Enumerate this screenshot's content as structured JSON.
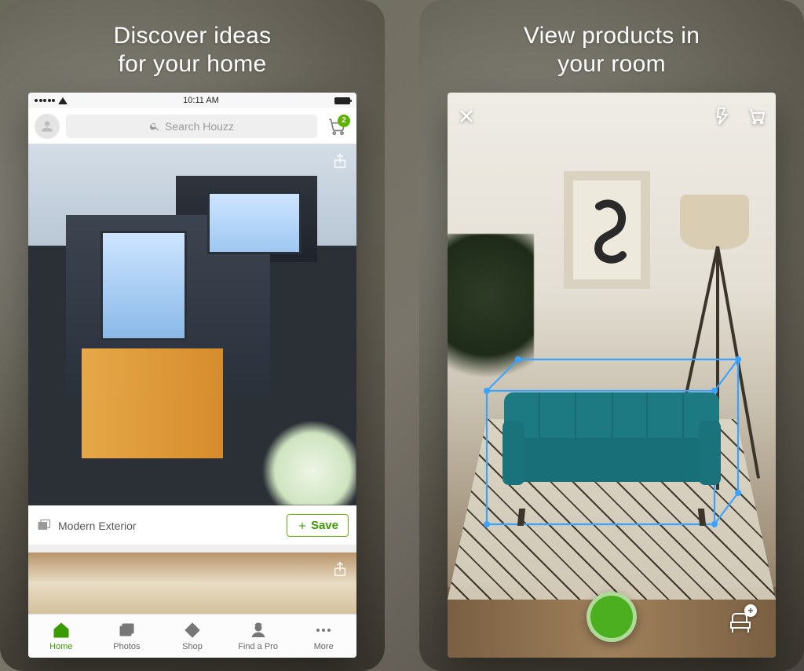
{
  "left": {
    "title_line1": "Discover ideas",
    "title_line2": "for your home",
    "statusbar_time": "10:11 AM",
    "search_placeholder": "Search Houzz",
    "cart_badge": "2",
    "card_caption": "Modern Exterior",
    "save_label": "Save",
    "tabs": {
      "home": "Home",
      "photos": "Photos",
      "shop": "Shop",
      "find_a_pro": "Find a Pro",
      "more": "More"
    }
  },
  "right": {
    "title_line1": "View products in",
    "title_line2": "your room"
  }
}
